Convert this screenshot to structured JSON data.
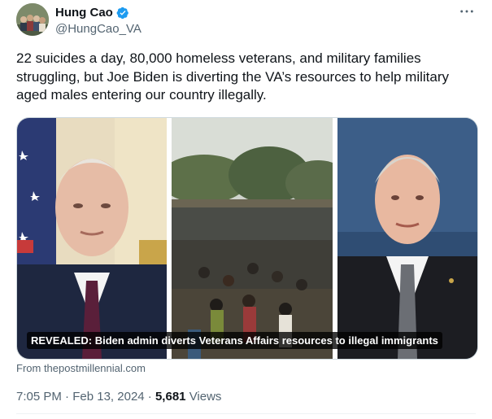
{
  "author": {
    "name": "Hung Cao",
    "handle": "@HungCao_VA",
    "verified": true,
    "accent_color": "#1d9bf0"
  },
  "more_icon": "more-horizontal-icon",
  "post": {
    "text": "22 suicides a day, 80,000 homeless veterans, and military families struggling, but Joe Biden is diverting the VA’s resources to help military aged males entering our country illegally."
  },
  "media": {
    "caption": "REVEALED: Biden admin diverts Veterans Affairs resources to illegal immigrants",
    "panels": [
      "portrait-left",
      "crowd-center",
      "portrait-right"
    ]
  },
  "link_source": "From thepostmillennial.com",
  "meta": {
    "time": "7:05 PM",
    "separator": "·",
    "date": "Feb 13, 2024",
    "views_count": "5,681",
    "views_label": "Views"
  }
}
